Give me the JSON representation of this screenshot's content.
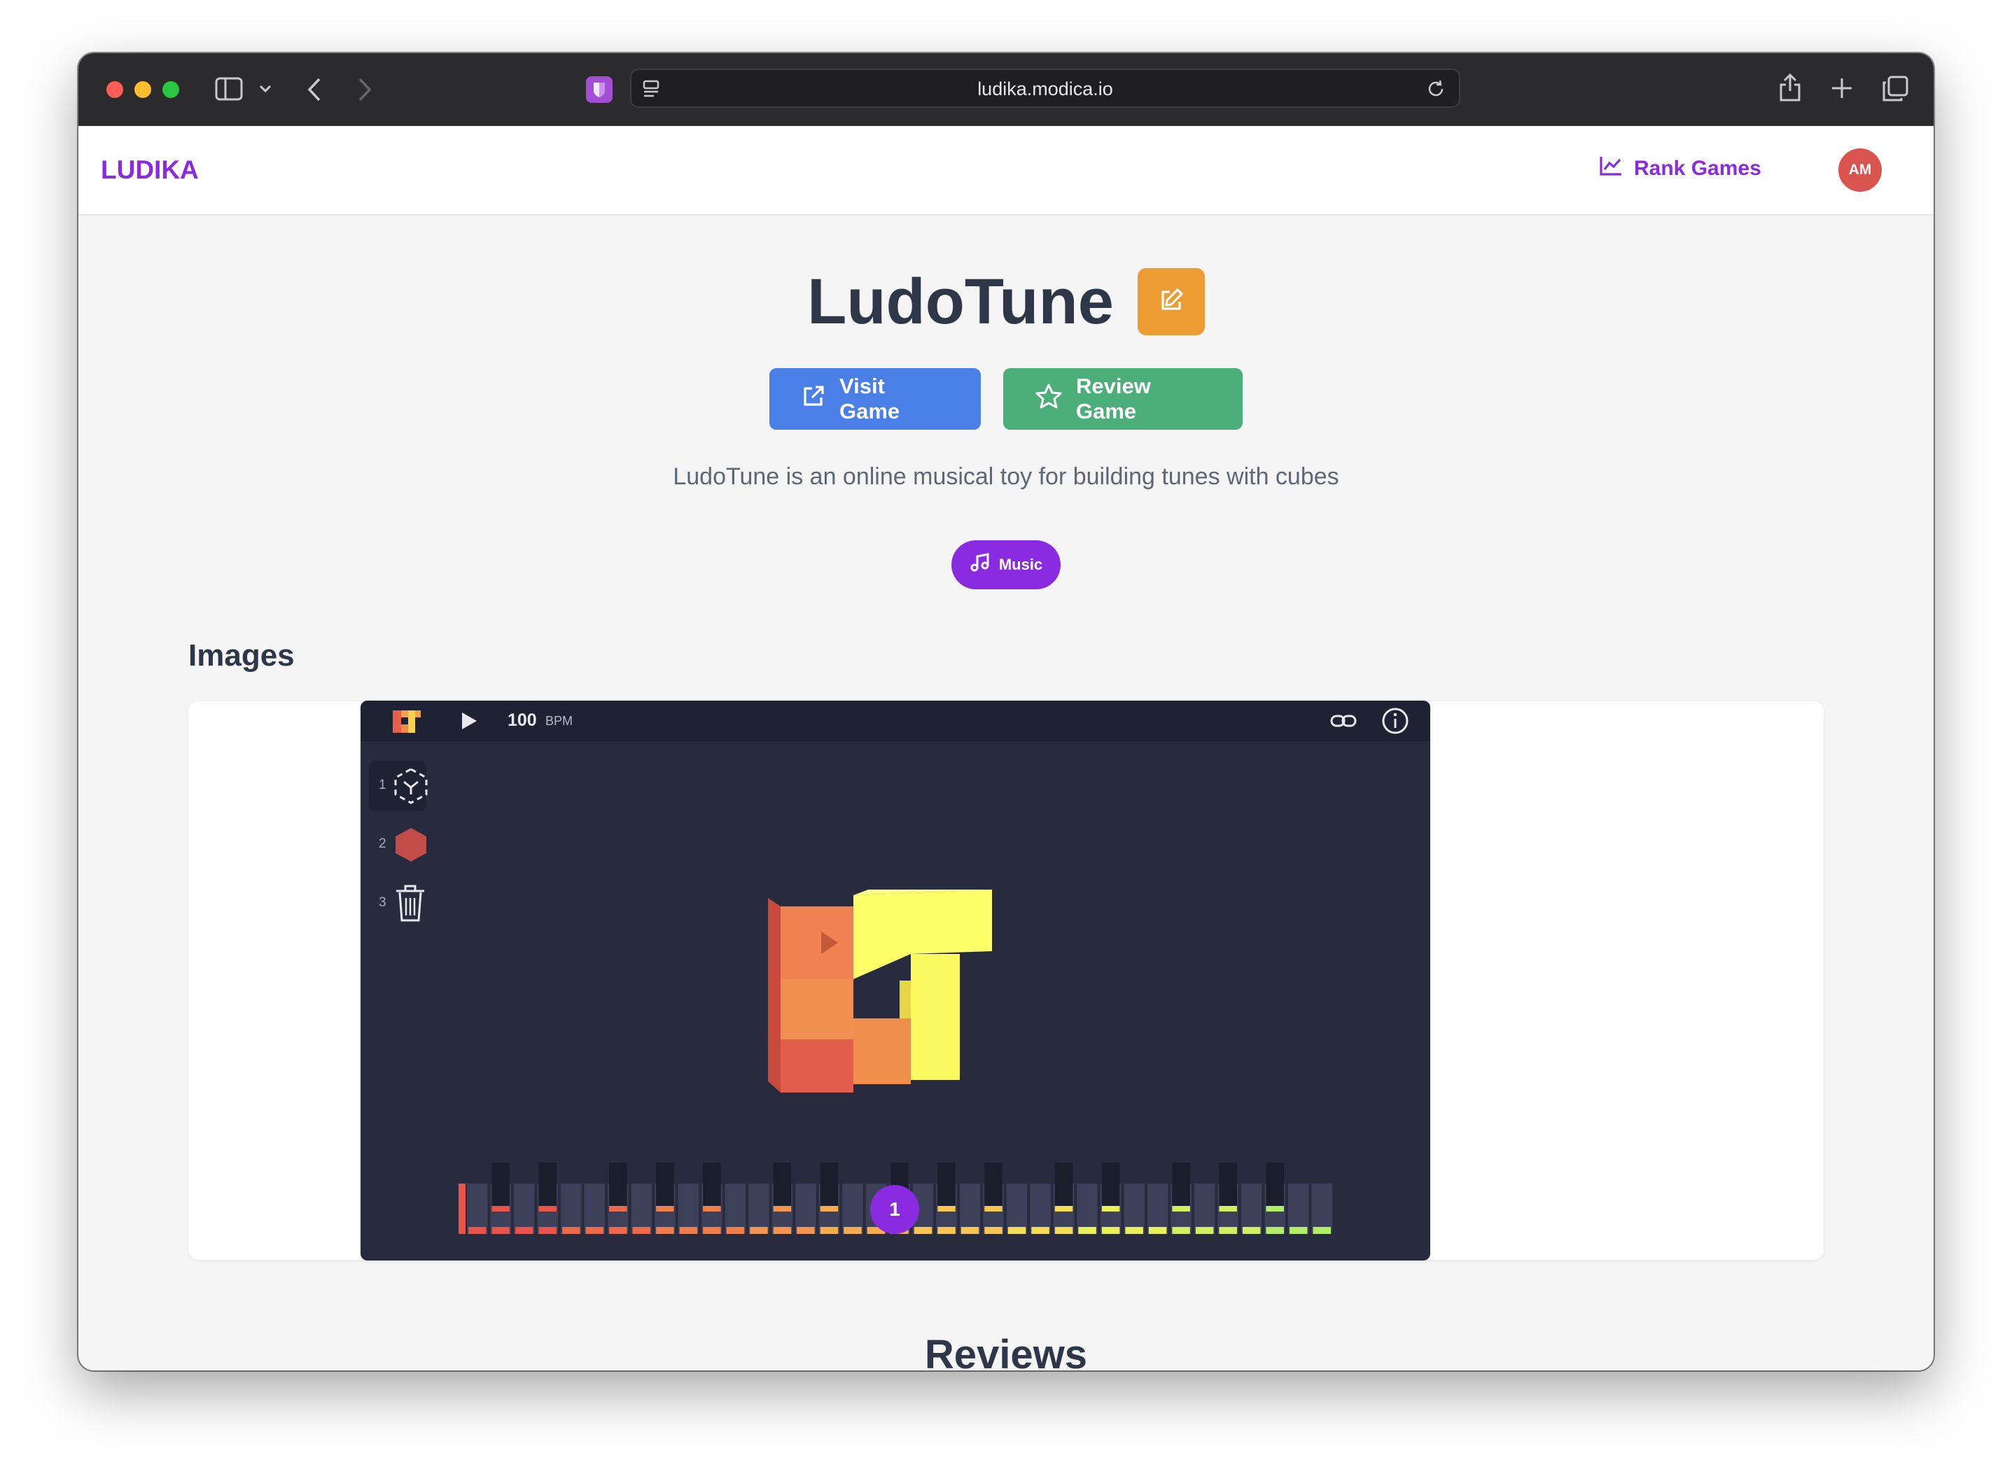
{
  "browser": {
    "url": "ludika.modica.io",
    "traffic_lights": {
      "close": "#ff5f57",
      "minimize": "#febc2e",
      "zoom": "#28c840"
    }
  },
  "navbar": {
    "brand": "LUDIKA",
    "rank_games_label": "Rank Games",
    "avatar_initials": "AM",
    "accent_color": "#8a2be2"
  },
  "game": {
    "title": "LudoTune",
    "visit_label": "Visit Game",
    "review_label": "Review Game",
    "description": "LudoTune is an online musical toy for building tunes with cubes",
    "tag": "Music"
  },
  "images_section": {
    "title": "Images",
    "screenshot": {
      "bpm_value": "100",
      "bpm_unit": "BPM",
      "tools": [
        "1",
        "2",
        "3"
      ],
      "playhead_label": "1"
    }
  },
  "reviews_section": {
    "title": "Reviews"
  }
}
